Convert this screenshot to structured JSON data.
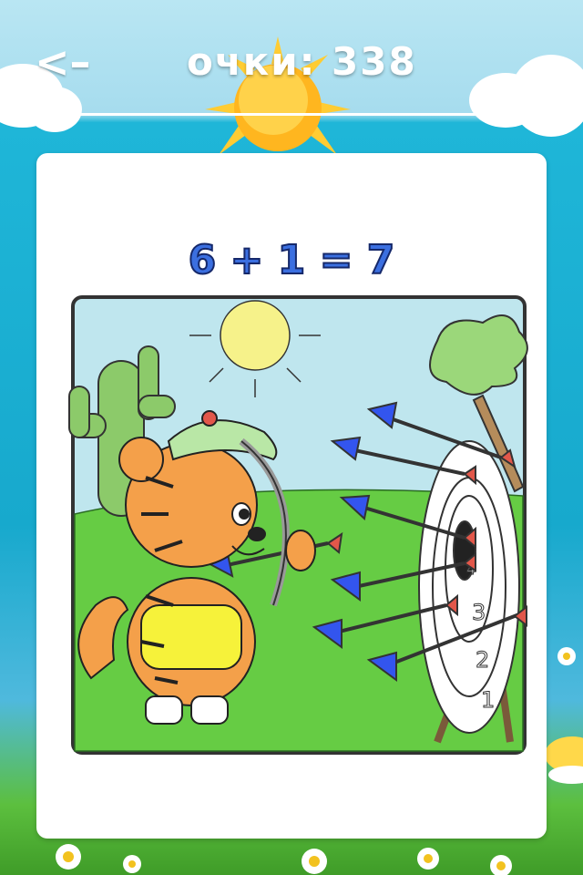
{
  "header": {
    "back_label": "<–",
    "score_label": "очки:",
    "score_value": "338"
  },
  "picture": {
    "equation": "6 + 1 = 7",
    "target_numbers": [
      "4",
      "3",
      "2",
      "1"
    ]
  },
  "colors": {
    "sky": "#a6dcee",
    "sea": "#17a9cd",
    "equation_blue": "#3b6fe0",
    "tiger_orange": "#f4a04a",
    "grass": "#66cc44",
    "arrow_blue": "#3355ee",
    "arrow_tip": "#e2574a"
  }
}
